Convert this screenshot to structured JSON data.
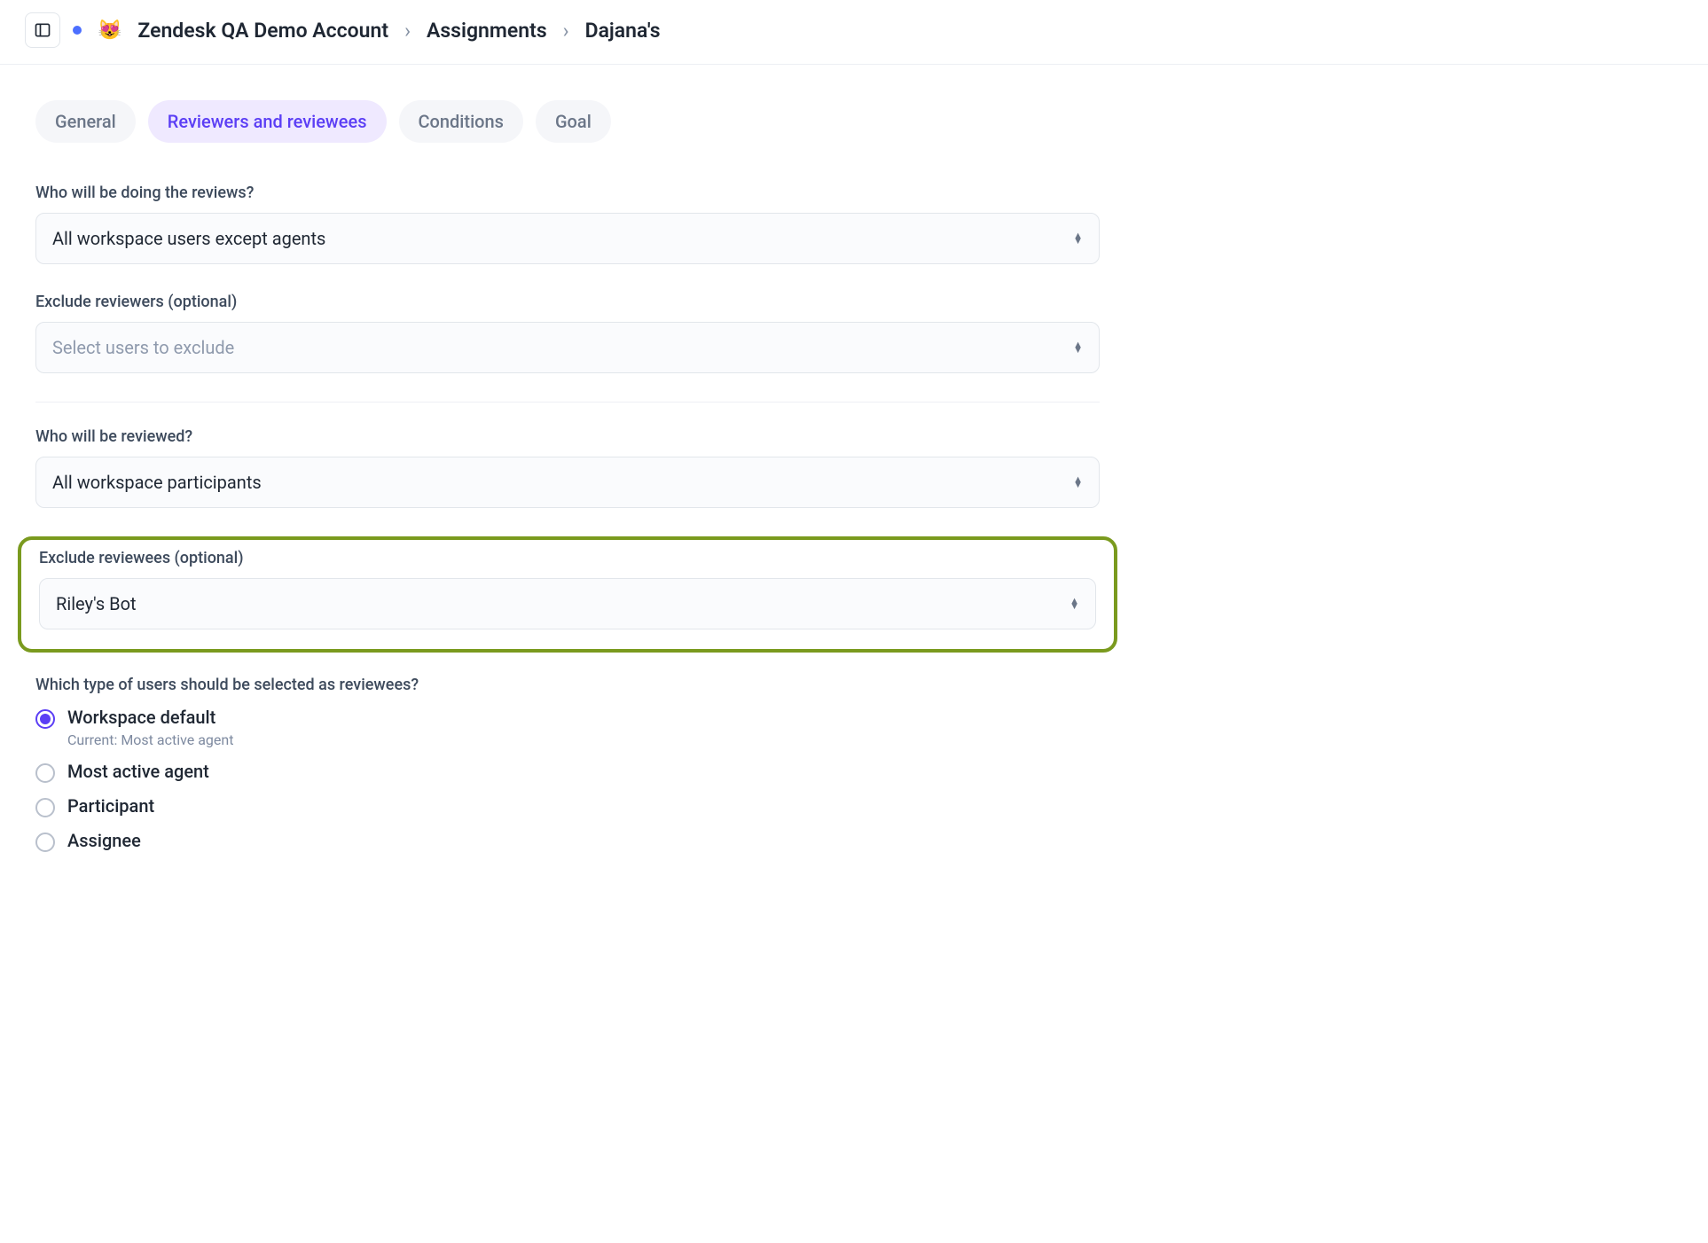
{
  "breadcrumb": {
    "emoji": "😻",
    "account": "Zendesk QA Demo Account",
    "section": "Assignments",
    "item": "Dajana's"
  },
  "tabs": [
    {
      "label": "General",
      "active": false
    },
    {
      "label": "Reviewers and reviewees",
      "active": true
    },
    {
      "label": "Conditions",
      "active": false
    },
    {
      "label": "Goal",
      "active": false
    }
  ],
  "reviewers": {
    "label": "Who will be doing the reviews?",
    "value": "All workspace users except agents",
    "exclude_label": "Exclude reviewers (optional)",
    "exclude_placeholder": "Select users to exclude"
  },
  "reviewees": {
    "label": "Who will be reviewed?",
    "value": "All workspace participants",
    "exclude_label": "Exclude reviewees (optional)",
    "exclude_value": "Riley's Bot",
    "type_label": "Which type of users should be selected as reviewees?",
    "type_options": [
      {
        "label": "Workspace default",
        "sub": "Current: Most active agent",
        "checked": true
      },
      {
        "label": "Most active agent",
        "sub": "",
        "checked": false
      },
      {
        "label": "Participant",
        "sub": "",
        "checked": false
      },
      {
        "label": "Assignee",
        "sub": "",
        "checked": false
      }
    ]
  }
}
